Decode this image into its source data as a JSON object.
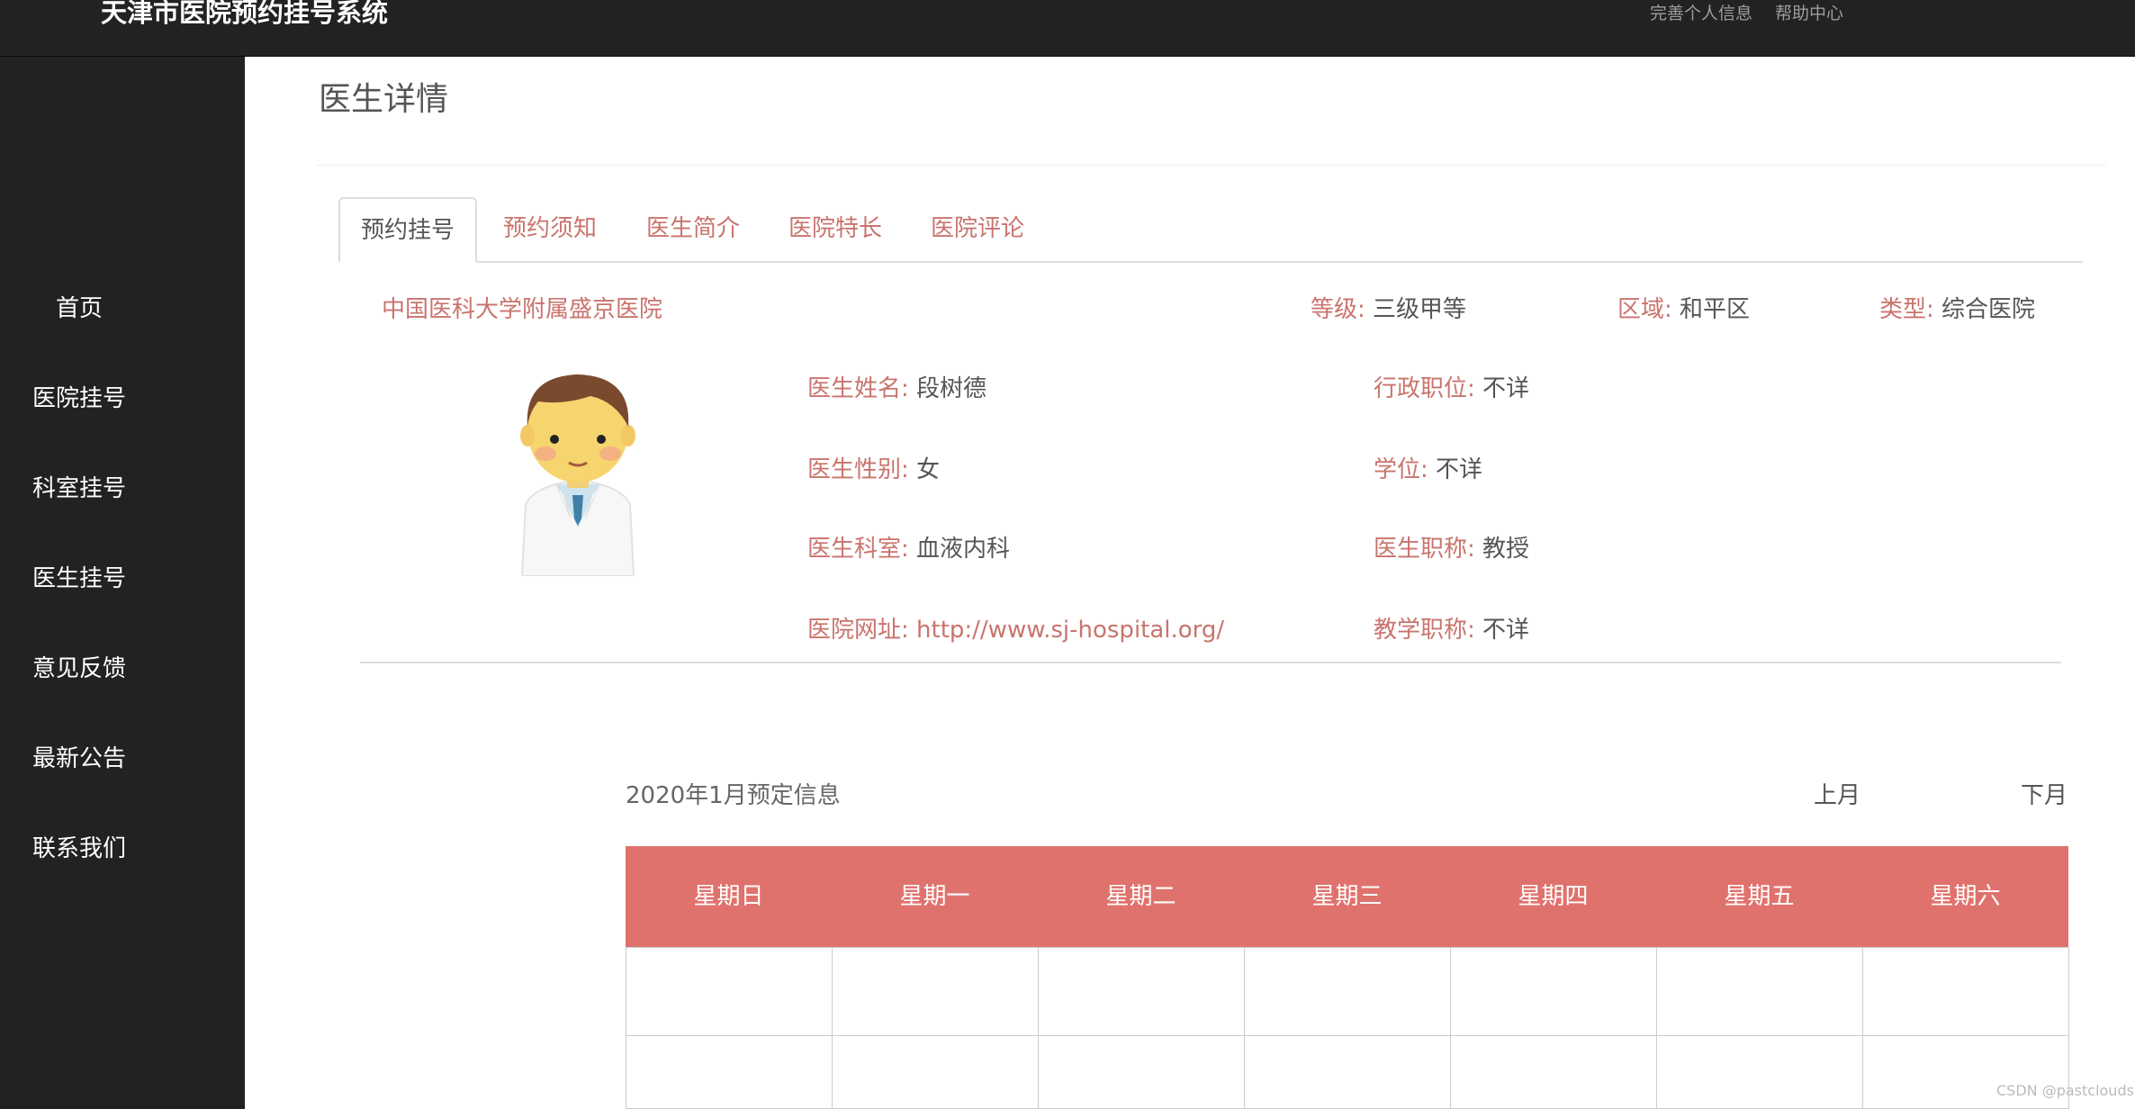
{
  "header": {
    "brand": "天津市医院预约挂号系统",
    "links": [
      "完善个人信息",
      "帮助中心"
    ]
  },
  "sidebar": {
    "items": [
      "首页",
      "医院挂号",
      "科室挂号",
      "医生挂号",
      "意见反馈",
      "最新公告",
      "联系我们"
    ]
  },
  "page": {
    "title": "医生详情"
  },
  "tabs": [
    "预约挂号",
    "预约须知",
    "医生简介",
    "医院特长",
    "医院评论"
  ],
  "hospital": {
    "name": "中国医科大学附属盛京医院",
    "grade_label": "等级:",
    "grade": "三级甲等",
    "region_label": "区域:",
    "region": "和平区",
    "type_label": "类型:",
    "type": "综合医院"
  },
  "doctor": {
    "name_label": "医生姓名:",
    "name": "段树德",
    "gender_label": "医生性别:",
    "gender": "女",
    "dept_label": "医生科室:",
    "dept": "血液内科",
    "website_label": "医院网址:",
    "website": "http://www.sj-hospital.org/",
    "admin_label": "行政职位:",
    "admin": "不详",
    "degree_label": "学位:",
    "degree": "不详",
    "title_label": "医生职称:",
    "title": "教授",
    "teaching_label": "教学职称:",
    "teaching": "不详"
  },
  "calendar": {
    "title": "2020年1月预定信息",
    "prev": "上月",
    "next": "下月",
    "weekdays": [
      "星期日",
      "星期一",
      "星期二",
      "星期三",
      "星期四",
      "星期五",
      "星期六"
    ]
  },
  "watermark": "CSDN @pastclouds",
  "colors": {
    "accent": "#c9746d",
    "table_header": "#e0726d",
    "dark": "#222222"
  }
}
